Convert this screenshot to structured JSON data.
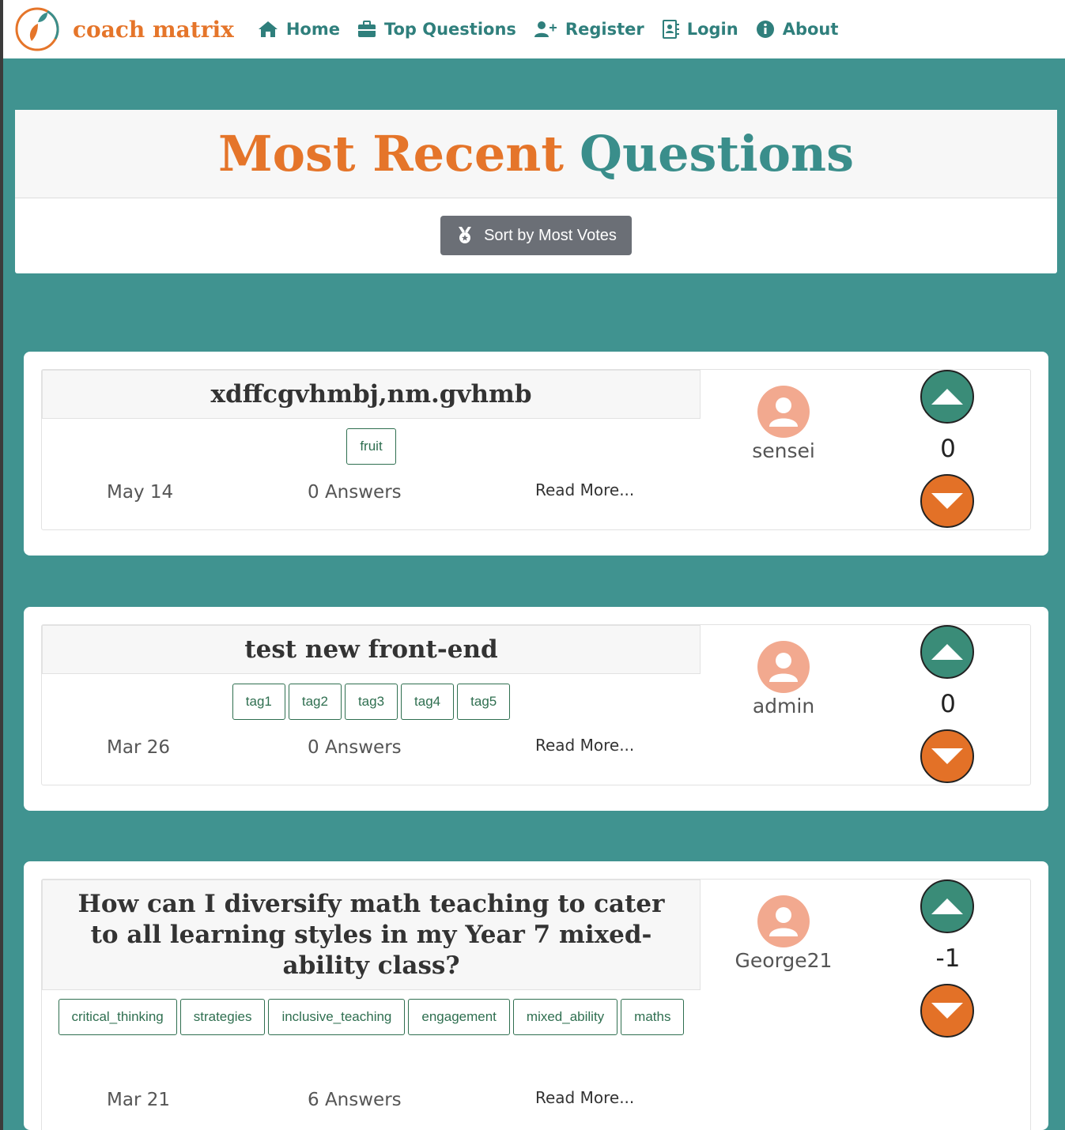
{
  "nav": {
    "brand": "coach matrix",
    "items": [
      {
        "label": "Home",
        "icon": "home-icon"
      },
      {
        "label": "Top Questions",
        "icon": "briefcase-icon"
      },
      {
        "label": "Register",
        "icon": "user-plus-icon"
      },
      {
        "label": "Login",
        "icon": "contact-book-icon"
      },
      {
        "label": "About",
        "icon": "info-circle-icon"
      }
    ]
  },
  "header": {
    "title_part1": "Most Recent",
    "title_part2": "Questions",
    "sort_button": "Sort by Most Votes"
  },
  "questions": [
    {
      "title": "xdffcgvhmbj,nm.gvhmb",
      "tags": [
        "fruit"
      ],
      "date": "May 14",
      "answers": "0 Answers",
      "read_more": "Read More...",
      "author": "sensei",
      "votes": "0"
    },
    {
      "title": "test new front-end",
      "tags": [
        "tag1",
        "tag2",
        "tag3",
        "tag4",
        "tag5"
      ],
      "date": "Mar 26",
      "answers": "0 Answers",
      "read_more": "Read More...",
      "author": "admin",
      "votes": "0"
    },
    {
      "title": "How can I diversify math teaching to cater to all learning styles in my Year 7 mixed-ability class?",
      "tags": [
        "critical_thinking",
        "strategies",
        "inclusive_teaching",
        "engagement",
        "mixed_ability",
        "maths"
      ],
      "date": "Mar 21",
      "answers": "6 Answers",
      "read_more": "Read More...",
      "author": "George21",
      "votes": "-1"
    }
  ],
  "colors": {
    "background": "#409390",
    "accent_orange": "#e5752a",
    "accent_teal": "#3a8e8b",
    "upvote": "#3a8c78",
    "downvote": "#e37127",
    "tag": "#2f6f50"
  }
}
